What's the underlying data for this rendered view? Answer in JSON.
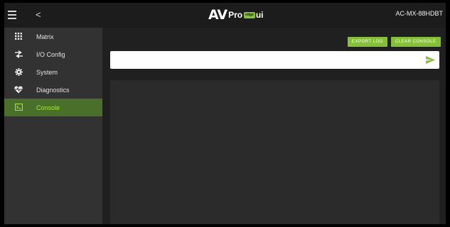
{
  "header": {
    "back_glyph": "<",
    "logo_av": "AV",
    "logo_pro": "Pro",
    "logo_badge": "edge",
    "logo_ui": "ui",
    "model": "AC-MX-88HDBT"
  },
  "sidebar": {
    "items": [
      {
        "label": "Matrix",
        "icon": "grid-icon",
        "active": false
      },
      {
        "label": "I/O Config",
        "icon": "arrows-swap-icon",
        "active": false
      },
      {
        "label": "System",
        "icon": "gear-icon",
        "active": false
      },
      {
        "label": "Diagnostics",
        "icon": "heart-pulse-icon",
        "active": false
      },
      {
        "label": "Console",
        "icon": "terminal-icon",
        "active": true
      }
    ]
  },
  "toolbar": {
    "export_label": "EXPORT LOG",
    "clear_label": "CLEAR CONSOLE"
  },
  "console": {
    "input_value": "",
    "input_placeholder": "",
    "log_lines": []
  },
  "colors": {
    "accent": "#86bf3a",
    "active_bg": "#4a6f2a",
    "active_text": "#a6e83e"
  }
}
